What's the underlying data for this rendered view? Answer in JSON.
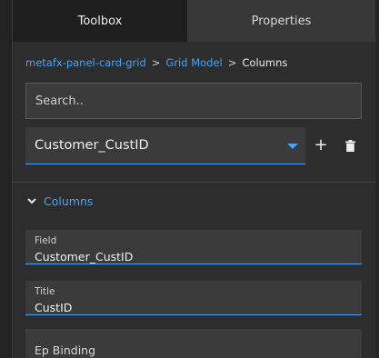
{
  "tabs": [
    {
      "label": "Toolbox",
      "active": true
    },
    {
      "label": "Properties",
      "active": false
    }
  ],
  "breadcrumb": {
    "items": [
      "metafx-panel-card-grid",
      "Grid Model"
    ],
    "current": "Columns",
    "separator": ">"
  },
  "search": {
    "placeholder": "Search.."
  },
  "column_select": {
    "value": "Customer_CustID",
    "add_icon": "plus-icon",
    "delete_icon": "trash-icon"
  },
  "section": {
    "label": "Columns",
    "expanded": true
  },
  "fields": [
    {
      "label": "Field",
      "value": "Customer_CustID"
    },
    {
      "label": "Title",
      "value": "CustID"
    },
    {
      "label": "Ep Binding",
      "value": ""
    }
  ],
  "colors": {
    "accent": "#3ea6ff",
    "panel_bg": "#2d2d2d",
    "input_bg": "#3b3b3b",
    "active_tab_bg": "#1e1e1e"
  }
}
